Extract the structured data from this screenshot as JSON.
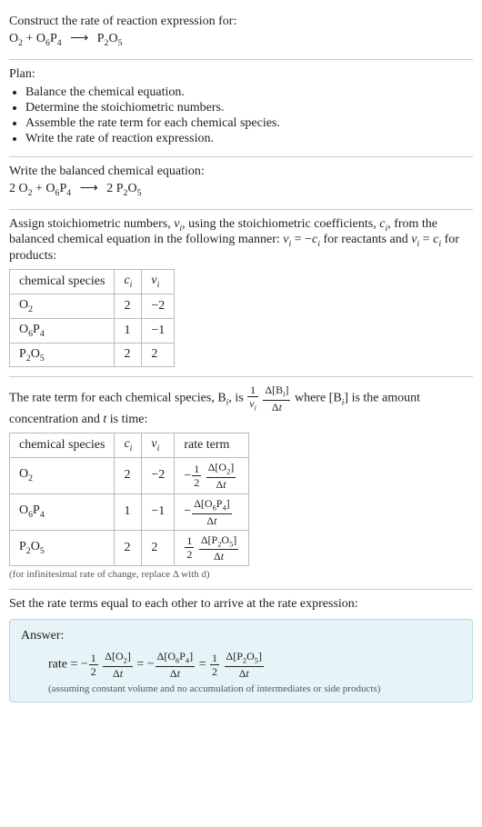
{
  "intro": {
    "prompt": "Construct the rate of reaction expression for:"
  },
  "plan": {
    "heading": "Plan:",
    "items": [
      "Balance the chemical equation.",
      "Determine the stoichiometric numbers.",
      "Assemble the rate term for each chemical species.",
      "Write the rate of reaction expression."
    ]
  },
  "balanced": {
    "heading": "Write the balanced chemical equation:"
  },
  "stoich": {
    "p1a": "Assign stoichiometric numbers, ",
    "p1b": ", using the stoichiometric coefficients, ",
    "p1c": ", from the balanced chemical equation in the following manner: ",
    "p1d": " for reactants and ",
    "p1e": " for products:",
    "headers": {
      "h1": "chemical species",
      "h2": "cᵢ",
      "h3": "νᵢ"
    },
    "rows": [
      {
        "c": "2",
        "v": "−2"
      },
      {
        "c": "1",
        "v": "−1"
      },
      {
        "c": "2",
        "v": "2"
      }
    ]
  },
  "rateterm": {
    "p1a": "The rate term for each chemical species, ",
    "p1b": ", is ",
    "p1c": " where ",
    "p1d": " is the amount concentration and ",
    "p1e": " is time:",
    "headers": {
      "h1": "chemical species",
      "h2": "cᵢ",
      "h3": "νᵢ",
      "h4": "rate term"
    },
    "rows": [
      {
        "c": "2",
        "v": "−2"
      },
      {
        "c": "1",
        "v": "−1"
      },
      {
        "c": "2",
        "v": "2"
      }
    ],
    "note": "(for infinitesimal rate of change, replace Δ with d)"
  },
  "final": {
    "heading": "Set the rate terms equal to each other to arrive at the rate expression:",
    "answer_label": "Answer:",
    "note": "(assuming constant volume and no accumulation of intermediates or side products)"
  },
  "chart_data": {
    "unbalanced_equation": {
      "reactants": [
        {
          "formula": "O2",
          "coeff": 1
        },
        {
          "formula": "O6P4",
          "coeff": 1
        }
      ],
      "products": [
        {
          "formula": "P2O5",
          "coeff": 1
        }
      ]
    },
    "balanced_equation": {
      "reactants": [
        {
          "formula": "O2",
          "coeff": 2
        },
        {
          "formula": "O6P4",
          "coeff": 1
        }
      ],
      "products": [
        {
          "formula": "P2O5",
          "coeff": 2
        }
      ]
    },
    "stoichiometric_numbers": [
      {
        "species": "O2",
        "c_i": 2,
        "nu_i": -2
      },
      {
        "species": "O6P4",
        "c_i": 1,
        "nu_i": -1
      },
      {
        "species": "P2O5",
        "c_i": 2,
        "nu_i": 2
      }
    ],
    "rate_terms": [
      {
        "species": "O2",
        "c_i": 2,
        "nu_i": -2,
        "term": "-(1/2) Δ[O2]/Δt"
      },
      {
        "species": "O6P4",
        "c_i": 1,
        "nu_i": -1,
        "term": "-Δ[O6P4]/Δt"
      },
      {
        "species": "P2O5",
        "c_i": 2,
        "nu_i": 2,
        "term": "(1/2) Δ[P2O5]/Δt"
      }
    ],
    "rate_expression": "rate = -(1/2) Δ[O2]/Δt = -Δ[O6P4]/Δt = (1/2) Δ[P2O5]/Δt"
  }
}
